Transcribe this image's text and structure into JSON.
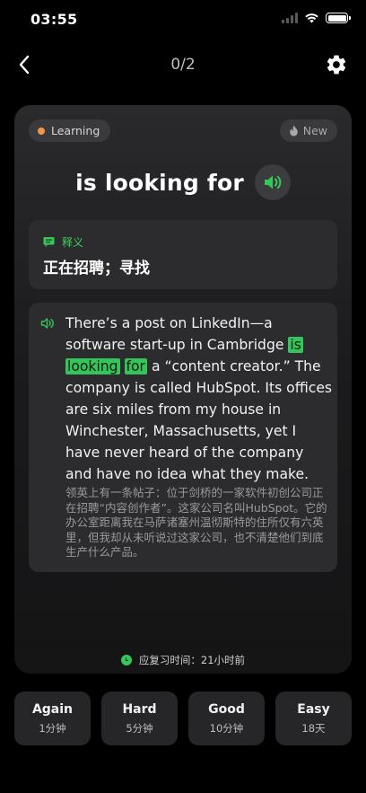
{
  "status_bar": {
    "time": "03:55"
  },
  "nav": {
    "progress": "0/2"
  },
  "card": {
    "status_badge": "Learning",
    "new_badge": "New",
    "word": "is looking for",
    "definition": {
      "label": "释义",
      "text": "正在招聘；寻找"
    },
    "example": {
      "before": "There’s a post on LinkedIn—a software start-up in Cambridge ",
      "highlights": [
        "is",
        "looking",
        "for"
      ],
      "after": " a “content creator.” The company is called HubSpot. Its offices are six miles from my house in Winchester, Massachusetts, yet I have never heard of the company and have no idea what they make.",
      "translation": "领英上有一条帖子：位于剑桥的一家软件初创公司正在招聘“内容创作者”。这家公司名叫HubSpot。它的办公室距离我在马萨诸塞州温彻斯特的住所仅有六英里，但我却从未听说过这家公司，也不清楚他们到底生产什么产品。"
    },
    "review_time": "应复习时间：21小时前"
  },
  "ratings": [
    {
      "label": "Again",
      "interval": "1分钟"
    },
    {
      "label": "Hard",
      "interval": "5分钟"
    },
    {
      "label": "Good",
      "interval": "10分钟"
    },
    {
      "label": "Easy",
      "interval": "18天"
    }
  ],
  "colors": {
    "accent_green": "#34c759",
    "learning_dot": "#f0954a",
    "card_bg": "#1c1c1e"
  },
  "icons": [
    "back-chevron-icon",
    "gear-icon",
    "flame-icon",
    "speaker-icon",
    "chat-icon",
    "clock-icon"
  ]
}
